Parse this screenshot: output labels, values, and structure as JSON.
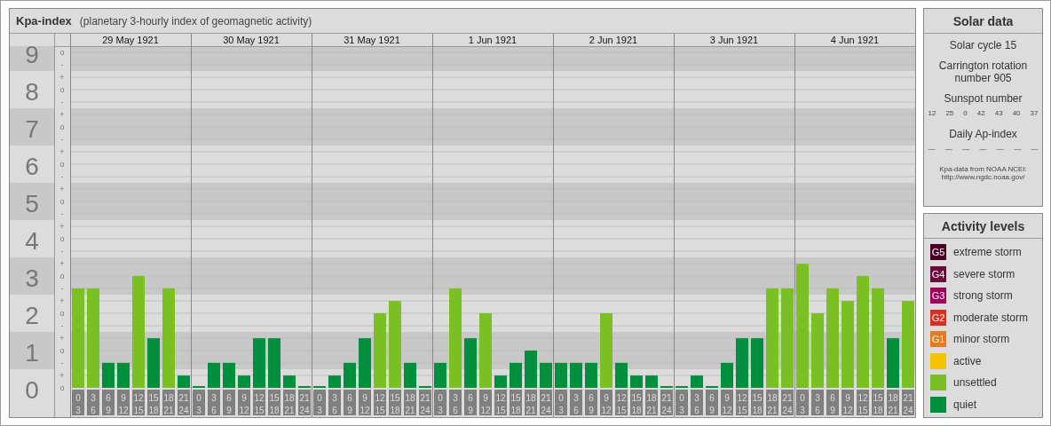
{
  "header": {
    "title": "Kpa-index",
    "subtitle": "(planetary 3-hourly index of geomagnetic activity)"
  },
  "days": [
    "29 May 1921",
    "30 May 1921",
    "31 May 1921",
    "1 Jun 1921",
    "2 Jun 1921",
    "3 Jun 1921",
    "4 Jun 1921"
  ],
  "subticks": [
    "o",
    "-",
    "+",
    "o",
    "-",
    "+",
    "o",
    "-",
    "+",
    "o",
    "-",
    "+",
    "o",
    "-",
    "+",
    "o",
    "-",
    "+",
    "o",
    "-",
    "+",
    "o",
    "-",
    "+",
    "o",
    "-",
    "+",
    "o"
  ],
  "chart_data": {
    "type": "bar",
    "grid": true,
    "ylim": [
      0,
      9.17
    ],
    "yticks": [
      0,
      1,
      2,
      3,
      4,
      5,
      6,
      7,
      8,
      9
    ],
    "categories": [
      "0 3",
      "3 6",
      "6 9",
      "9 12",
      "12 15",
      "15 18",
      "18 21",
      "21 24",
      "0 3",
      "3 6",
      "6 9",
      "9 12",
      "12 15",
      "15 18",
      "18 21",
      "21 24",
      "0 3",
      "3 6",
      "6 9",
      "9 12",
      "12 15",
      "15 18",
      "18 21",
      "21 24",
      "0 3",
      "3 6",
      "6 9",
      "9 12",
      "12 15",
      "15 18",
      "18 21",
      "21 24",
      "0 3",
      "3 6",
      "6 9",
      "9 12",
      "12 15",
      "15 18",
      "18 21",
      "21 24",
      "0 3",
      "3 6",
      "6 9",
      "9 12",
      "12 15",
      "15 18",
      "18 21",
      "21 24",
      "0 3",
      "3 6",
      "6 9",
      "9 12",
      "12 15",
      "15 18",
      "18 21",
      "21 24"
    ],
    "values": [
      2.67,
      2.67,
      0.67,
      0.67,
      3,
      1.33,
      2.67,
      0.33,
      0,
      0.67,
      0.67,
      0.33,
      1.33,
      1.33,
      0.33,
      0,
      0,
      0.33,
      0.67,
      1.33,
      2,
      2.33,
      0.67,
      0,
      0.67,
      2.67,
      1.33,
      2,
      0.33,
      0.67,
      1,
      0.67,
      0.67,
      0.67,
      0.67,
      2,
      0.67,
      0.33,
      0.33,
      0,
      0,
      0.33,
      0,
      0.67,
      1.33,
      1.33,
      2.67,
      2.67,
      3.33,
      2,
      2.67,
      2.33,
      3,
      2.67,
      1.33,
      2.33
    ]
  },
  "solar_data": {
    "title": "Solar data",
    "solar_cycle": "Solar cycle 15",
    "carrington": "Carrington rotation number 905",
    "sunspot_title": "Sunspot number",
    "sunspot_numbers": [
      "12",
      "25",
      "0",
      "42",
      "43",
      "40",
      "37"
    ],
    "ap_title": "Daily Ap-index",
    "ap_values": [
      "—",
      "—",
      "—",
      "—",
      "—",
      "—",
      "—"
    ],
    "source": "Kpa-data from NOAA NCEI:",
    "source_url": "http://www.ngdc.noaa.gov/"
  },
  "activity_levels": {
    "title": "Activity levels",
    "items": [
      {
        "badge": "G5",
        "label": "extreme storm",
        "color": "#4b0021"
      },
      {
        "badge": "G4",
        "label": "severe storm",
        "color": "#6e0a3c"
      },
      {
        "badge": "G3",
        "label": "strong storm",
        "color": "#a0005a"
      },
      {
        "badge": "G2",
        "label": "moderate storm",
        "color": "#d7301f"
      },
      {
        "badge": "G1",
        "label": "minor storm",
        "color": "#e87a1e"
      },
      {
        "label": "active",
        "color": "#f5c400"
      },
      {
        "label": "unsettled",
        "color": "#7ac023"
      },
      {
        "label": "quiet",
        "color": "#008f3d"
      }
    ]
  }
}
